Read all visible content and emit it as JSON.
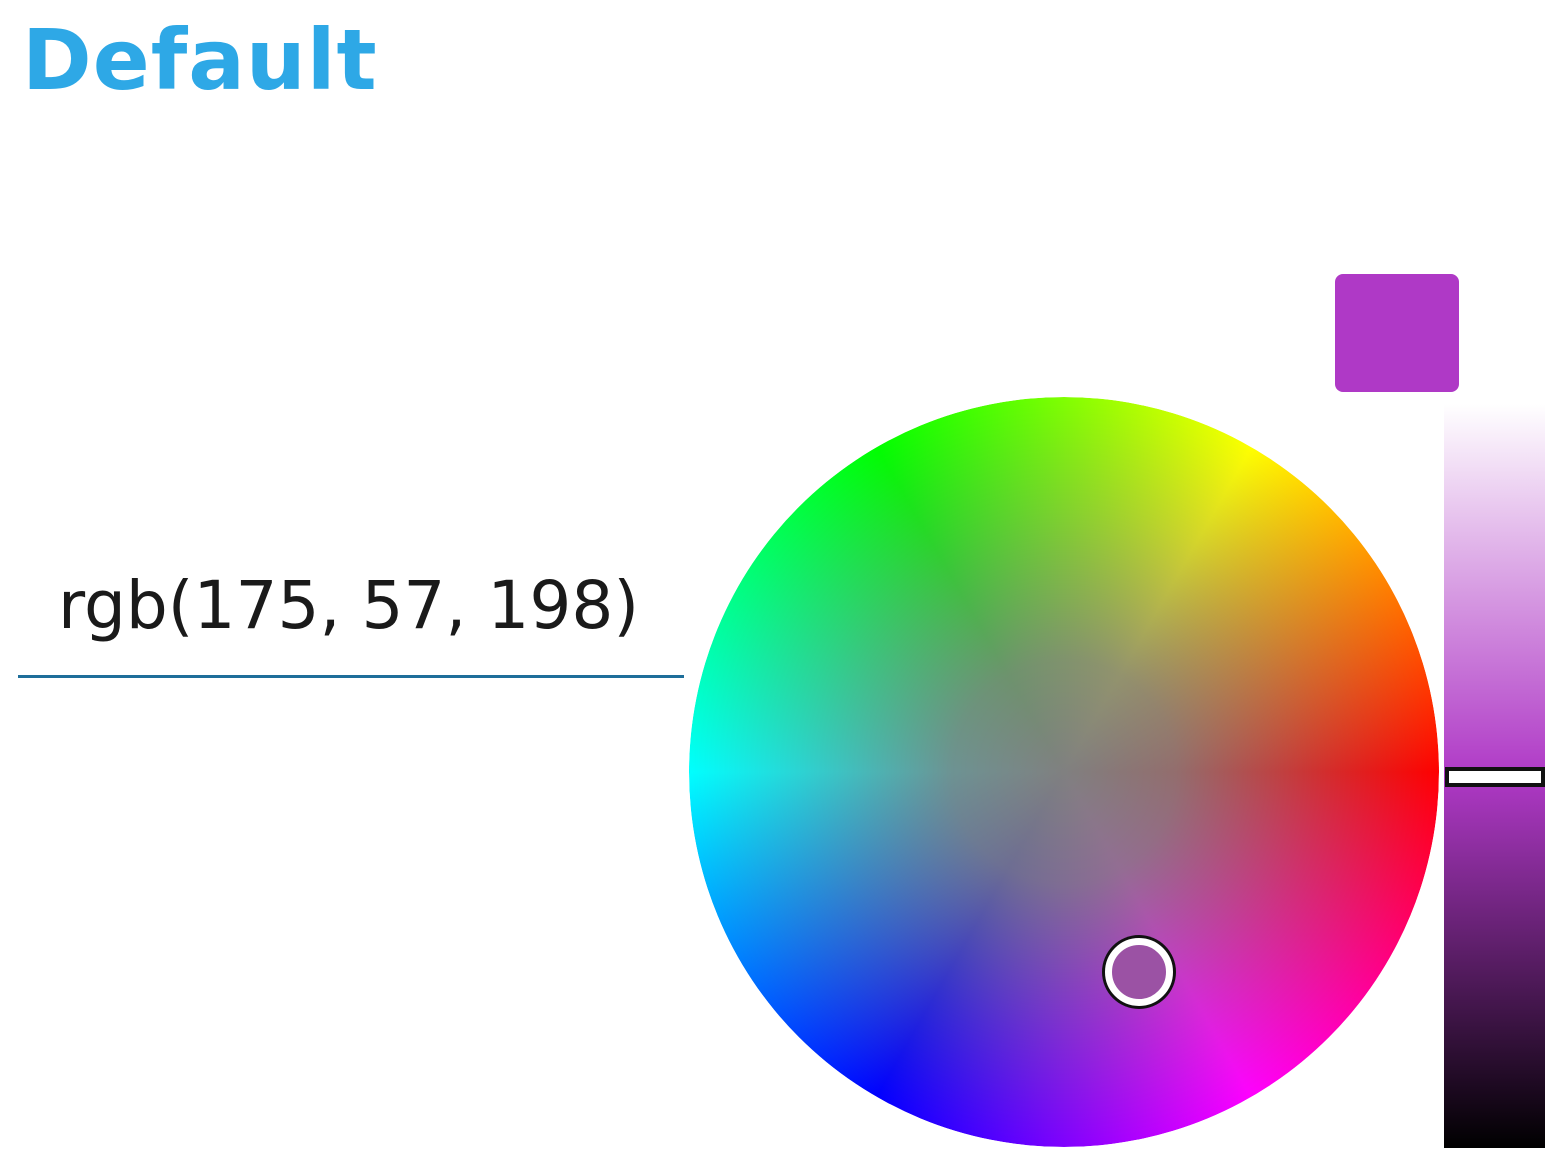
{
  "header": {
    "title": "Default",
    "title_color": "#2ea8e6"
  },
  "color_input": {
    "value": "rgb(175, 57, 198)"
  },
  "color_picker": {
    "selected_color": "#af39c6",
    "preview_color": "#af39c6",
    "wheel_thumb_color": "#9b52a4",
    "brightness_slider": {
      "top_color": "#ffffff",
      "mid_color": "#af39c6",
      "bottom_color": "#000000",
      "level": 0.5
    },
    "icons": {
      "wheel_thumb": "ring-handle-icon",
      "slider_thumb": "bar-handle-icon"
    }
  }
}
